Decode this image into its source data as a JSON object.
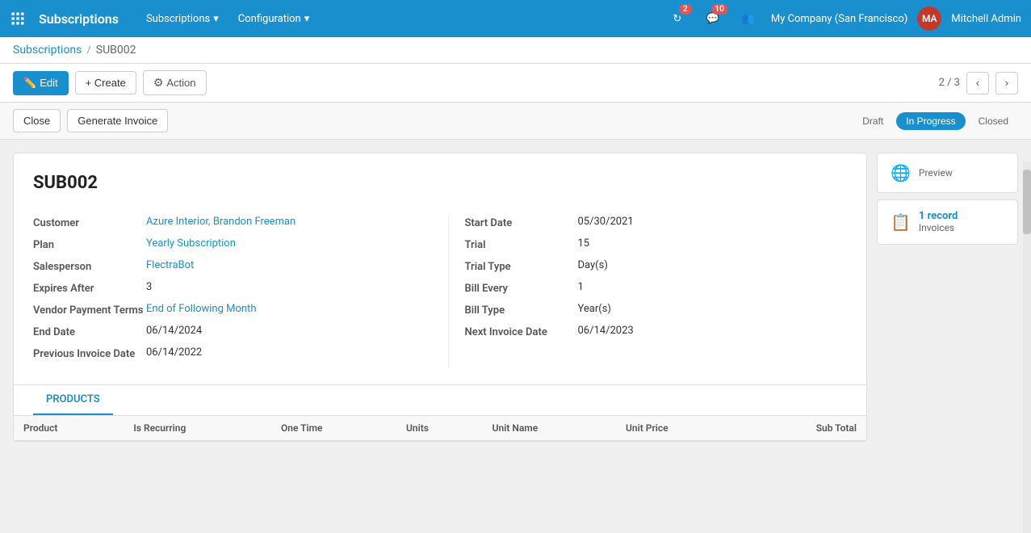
{
  "topnav": {
    "app_title": "Subscriptions",
    "menus": [
      {
        "label": "Subscriptions",
        "has_dropdown": true
      },
      {
        "label": "Configuration",
        "has_dropdown": true
      }
    ],
    "notifications": [
      {
        "icon": "refresh-icon",
        "count": "2"
      },
      {
        "icon": "chat-icon",
        "count": "10"
      },
      {
        "icon": "users-icon",
        "count": null
      }
    ],
    "company": "My Company (San Francisco)",
    "user": "Mitchell Admin"
  },
  "breadcrumb": {
    "parent": "Subscriptions",
    "current": "SUB002"
  },
  "toolbar": {
    "edit_label": "Edit",
    "create_label": "+ Create",
    "action_label": "Action",
    "pager": "2 / 3"
  },
  "status_bar": {
    "buttons": [
      {
        "label": "Close",
        "is_action": false
      },
      {
        "label": "Generate Invoice",
        "is_action": false
      }
    ],
    "statuses": [
      {
        "label": "Draft",
        "active": false
      },
      {
        "label": "In Progress",
        "active": true
      },
      {
        "label": "Closed",
        "active": false
      }
    ]
  },
  "preview_button": {
    "label": "Preview"
  },
  "invoices_button": {
    "count": "1 record",
    "label": "Invoices"
  },
  "form": {
    "title": "SUB002",
    "left": {
      "fields": [
        {
          "label": "Customer",
          "value": "Azure Interior, Brandon Freeman",
          "is_link": true
        },
        {
          "label": "Plan",
          "value": "Yearly Subscription",
          "is_link": true
        },
        {
          "label": "Salesperson",
          "value": "FlectraBot",
          "is_link": true
        },
        {
          "label": "Expires After",
          "value": "3",
          "is_link": false
        },
        {
          "label": "Vendor Payment Terms",
          "value": "End of Following Month",
          "is_link": true
        },
        {
          "label": "End Date",
          "value": "06/14/2024",
          "is_link": false
        },
        {
          "label": "Previous Invoice Date",
          "value": "06/14/2022",
          "is_link": false
        }
      ]
    },
    "right": {
      "fields": [
        {
          "label": "Start Date",
          "value": "05/30/2021",
          "is_link": false
        },
        {
          "label": "Trial",
          "value": "15",
          "is_link": false
        },
        {
          "label": "Trial Type",
          "value": "Day(s)",
          "is_link": false
        },
        {
          "label": "Bill Every",
          "value": "1",
          "is_link": false
        },
        {
          "label": "Bill Type",
          "value": "Year(s)",
          "is_link": false
        },
        {
          "label": "Next Invoice Date",
          "value": "06/14/2023",
          "is_link": false
        }
      ]
    }
  },
  "tabs": [
    {
      "label": "PRODUCTS",
      "active": true
    }
  ],
  "table": {
    "columns": [
      {
        "label": "Product",
        "align": "left"
      },
      {
        "label": "Is Recurring",
        "align": "left"
      },
      {
        "label": "One Time",
        "align": "left"
      },
      {
        "label": "Units",
        "align": "left"
      },
      {
        "label": "Unit Name",
        "align": "left"
      },
      {
        "label": "Unit Price",
        "align": "left"
      },
      {
        "label": "Sub Total",
        "align": "right"
      }
    ],
    "rows": []
  }
}
